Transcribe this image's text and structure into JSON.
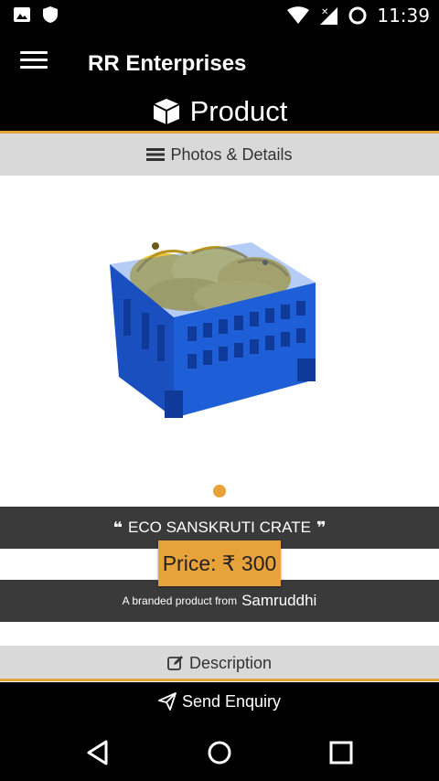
{
  "status_bar": {
    "time": "11:39",
    "left_icons": [
      "image-icon",
      "shield-icon"
    ],
    "right_icons": [
      "wifi-icon",
      "signal-icon",
      "battery-icon"
    ]
  },
  "app_bar": {
    "title": "RR Enterprises",
    "menu_icon": "hamburger-menu-icon"
  },
  "page": {
    "title": "Product",
    "icon": "cube-icon"
  },
  "section_tab": {
    "label": "Photos & Details",
    "icon": "list-icon"
  },
  "product": {
    "image_alt": "product-image",
    "name": "ECO SANSKRUTI CRATE",
    "price_label": "Price: ₹ 300",
    "brand_prefix": "A branded product from",
    "brand_name": "Samruddhi",
    "pager_count": 1,
    "pager_active": 0
  },
  "description": {
    "label": "Description",
    "icon": "edit-icon"
  },
  "actions": {
    "send_enquiry_label": "Send Enquiry",
    "send_icon": "send-icon"
  },
  "nav_bar": {
    "buttons": [
      "back-icon",
      "home-icon",
      "recents-icon"
    ]
  },
  "colors": {
    "accent": "#e8a23a",
    "dark_bar": "#3a3a3a",
    "light_bar": "#d9d9d9",
    "crate_blue": "#1e5fd8",
    "banana_yellow": "#e8c53a"
  }
}
